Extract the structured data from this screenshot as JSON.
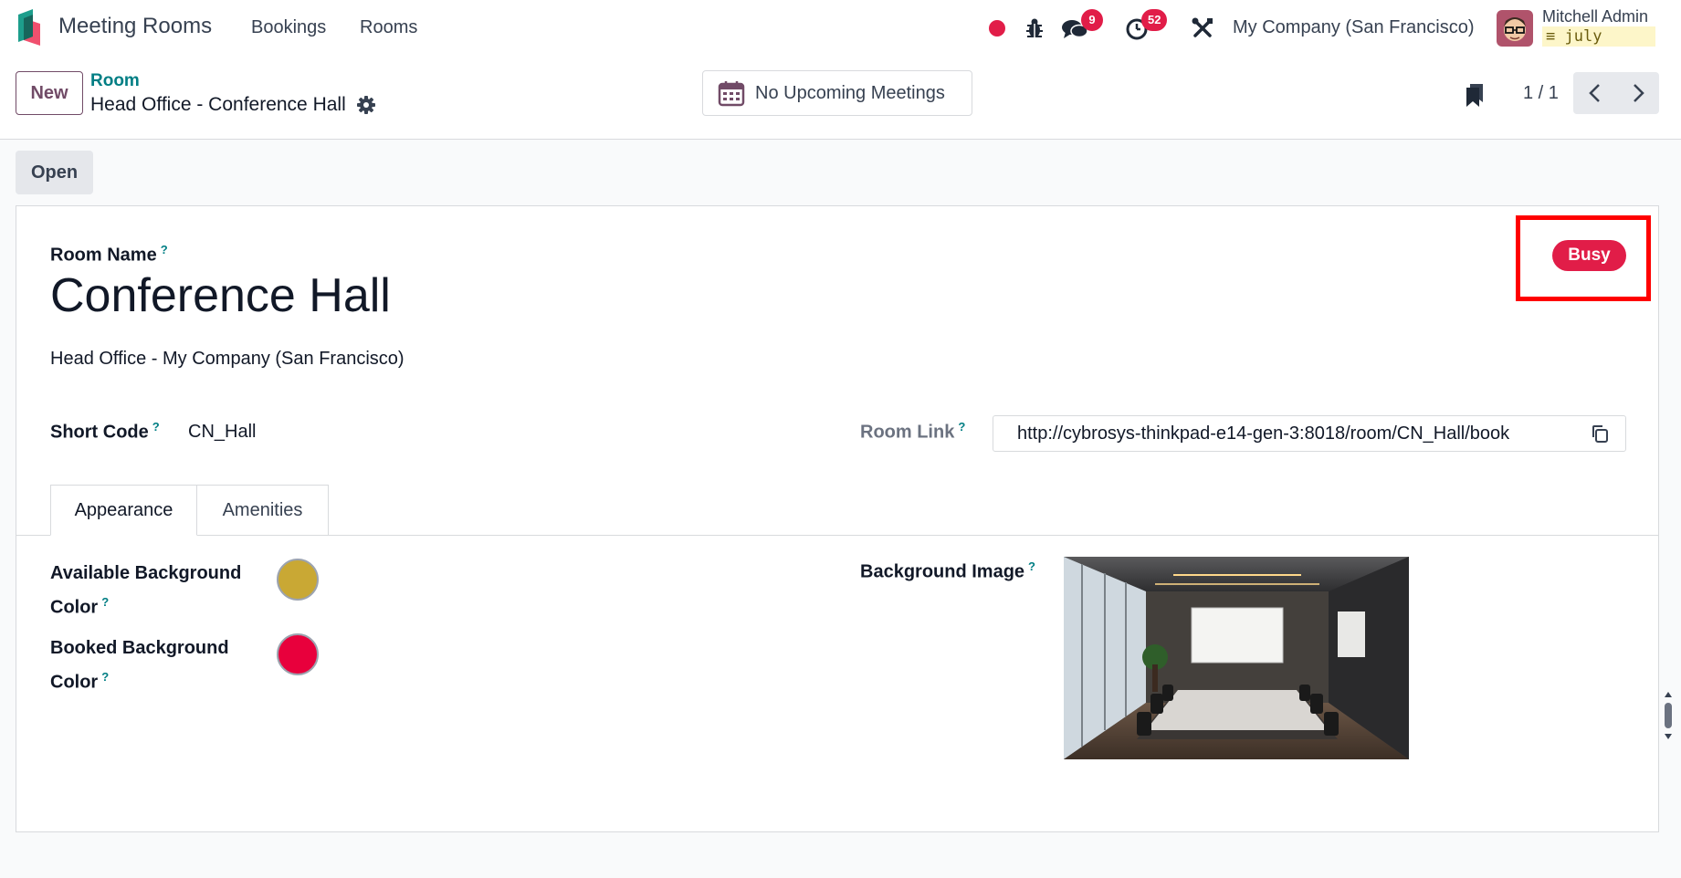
{
  "navbar": {
    "app_name": "Meeting Rooms",
    "menu": [
      "Bookings",
      "Rooms"
    ],
    "messages_count": "9",
    "activities_count": "52",
    "company": "My Company (San Francisco)",
    "user_name": "Mitchell Admin",
    "database": "july",
    "icons": [
      "record-dot-icon",
      "bug-icon",
      "chat-icon",
      "clock-icon",
      "tools-icon"
    ]
  },
  "control": {
    "new_label": "New",
    "breadcrumb_parent": "Room",
    "breadcrumb_current": "Head Office - Conference Hall",
    "meetings_label": "No Upcoming Meetings",
    "pager": "1 / 1"
  },
  "statusbar": {
    "open_label": "Open"
  },
  "form": {
    "room_name_label": "Room Name",
    "help_mark": "?",
    "room_name": "Conference Hall",
    "location": "Head Office - My Company (San Francisco)",
    "short_code_label": "Short Code",
    "short_code": "CN_Hall",
    "room_link_label": "Room Link",
    "room_link": "http://cybrosys-thinkpad-e14-gen-3:8018/room/CN_Hall/book",
    "status": "Busy",
    "tabs": [
      "Appearance",
      "Amenities"
    ],
    "available_color_label_1": "Available Background",
    "available_color_label_2": "Color",
    "booked_color_label_1": "Booked Background",
    "booked_color_label_2": "Color",
    "available_color": "#c9a834",
    "booked_color": "#e8003c",
    "background_image_label": "Background Image"
  },
  "colors": {
    "accent_purple": "#714b67",
    "accent_teal": "#017e84",
    "badge_red": "#e11d48",
    "highlight_red": "#ff0000"
  }
}
